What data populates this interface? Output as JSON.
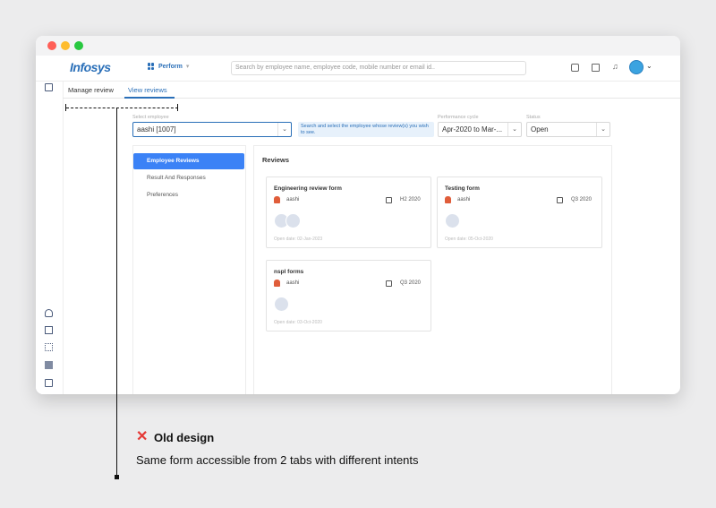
{
  "header": {
    "logo": "Infosys",
    "module": "Perform",
    "search_placeholder": "Search by employee name, employee code, mobile number or email id.."
  },
  "tabs": [
    {
      "label": "Manage review"
    },
    {
      "label": "View reviews"
    }
  ],
  "filters": {
    "employee_label": "Select employee",
    "employee_value": "aashi [1007]",
    "hint": "Search and select the employee whose review(s) you wish to see.",
    "cycle_label": "Performance cycle",
    "cycle_value": "Apr-2020 to Mar-...",
    "status_label": "Status",
    "status_value": "Open"
  },
  "sidebar": [
    {
      "label": "Employee Reviews"
    },
    {
      "label": "Result And Responses"
    },
    {
      "label": "Preferences"
    }
  ],
  "reviews": {
    "title": "Reviews",
    "cards": [
      {
        "title": "Engineering review form",
        "user": "aashi",
        "cycle": "H2 2020",
        "open_date": "Open date: 02-Jan-2023"
      },
      {
        "title": "Testing form",
        "user": "aashi",
        "cycle": "Q3 2020",
        "open_date": "Open date: 05-Oct-2020"
      },
      {
        "title": "nspl forms",
        "user": "aashi",
        "cycle": "Q3 2020",
        "open_date": "Open date: 03-Oct-2020"
      }
    ]
  },
  "annotation": {
    "icon": "x-mark",
    "color": "#e53935",
    "x_glyph": "✕",
    "title": "Old design",
    "caption": "Same form accessible from 2 tabs with different intents"
  }
}
